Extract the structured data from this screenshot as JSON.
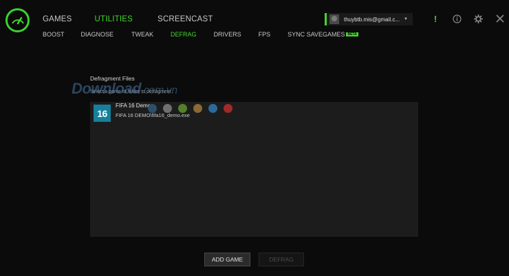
{
  "app": {
    "brand_color": "#44d62c"
  },
  "main_tabs": [
    {
      "label": "GAMES",
      "active": false
    },
    {
      "label": "UTILITIES",
      "active": true
    },
    {
      "label": "SCREENCAST",
      "active": false
    }
  ],
  "sub_tabs": [
    {
      "label": "BOOST",
      "active": false
    },
    {
      "label": "DIAGNOSE",
      "active": false
    },
    {
      "label": "TWEAK",
      "active": false
    },
    {
      "label": "DEFRAG",
      "active": true
    },
    {
      "label": "DRIVERS",
      "active": false
    },
    {
      "label": "FPS",
      "active": false
    },
    {
      "label": "SYNC SAVEGAMES",
      "active": false,
      "badge": "BETA"
    }
  ],
  "account": {
    "email": "thuybtb.mis@gmail.c...",
    "caret_icon": "chevron-down-icon"
  },
  "top_icons": [
    "alert-icon",
    "info-icon",
    "gear-icon",
    "close-icon"
  ],
  "defrag": {
    "title": "Defragment Files",
    "hint": "Select a game or folder to defragment",
    "games": [
      {
        "icon_text": "16",
        "name": "FIFA 16 Demo",
        "path": "FIFA 16 DEMO\\fifa16_demo.exe"
      }
    ],
    "status_dots": [
      "#2d4f6a",
      "#707070",
      "#55802a",
      "#8a6a35",
      "#2a6a9a",
      "#a02a2a"
    ]
  },
  "watermark": {
    "text": "Download",
    "suffix": ".com.vn"
  },
  "buttons": {
    "add_game": "ADD GAME",
    "defrag": "DEFRAG"
  }
}
